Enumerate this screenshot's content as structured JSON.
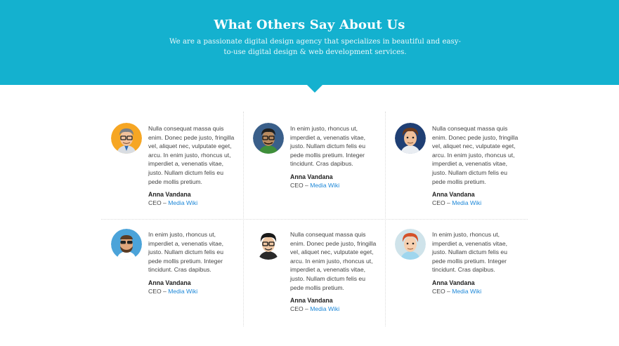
{
  "hero": {
    "title": "What Others Say About Us",
    "subtitle": "We are a passionate digital design agency that specializes in beautiful and easy-to-use digital design & web development services."
  },
  "colors": {
    "accent": "#14b1cf",
    "link": "#1e88d8"
  },
  "testimonials": [
    {
      "quote": "Nulla consequat massa quis enim. Donec pede justo, fringilla vel, aliquet nec, vulputate eget, arcu. In enim justo, rhoncus ut, imperdiet a, venenatis vitae, justo. Nullam dictum felis eu pede mollis pretium.",
      "name": "Anna Vandana",
      "role_prefix": "CEO – ",
      "company": "Media Wiki",
      "avatar": "man-glasses-orange-avatar-icon"
    },
    {
      "quote": "In enim justo, rhoncus ut, imperdiet a, venenatis vitae, justo. Nullam dictum felis eu pede mollis pretium. Integer tincidunt. Cras dapibus.",
      "name": "Anna Vandana",
      "role_prefix": "CEO – ",
      "company": "Media Wiki",
      "avatar": "man-glasses-green-avatar-icon"
    },
    {
      "quote": "Nulla consequat massa quis enim. Donec pede justo, fringilla vel, aliquet nec, vulputate eget, arcu. In enim justo, rhoncus ut, imperdiet a, venenatis vitae, justo. Nullam dictum felis eu pede mollis pretium.",
      "name": "Anna Vandana",
      "role_prefix": "CEO – ",
      "company": "Media Wiki",
      "avatar": "man-brown-hair-navy-avatar-icon"
    },
    {
      "quote": "In enim justo, rhoncus ut, imperdiet a, venenatis vitae, justo. Nullam dictum felis eu pede mollis pretium. Integer tincidunt. Cras dapibus.",
      "name": "Anna Vandana",
      "role_prefix": "CEO – ",
      "company": "Media Wiki",
      "avatar": "man-sunglasses-beard-avatar-icon"
    },
    {
      "quote": "Nulla consequat massa quis enim. Donec pede justo, fringilla vel, aliquet nec, vulputate eget, arcu. In enim justo, rhoncus ut, imperdiet a, venenatis vitae, justo. Nullam dictum felis eu pede mollis pretium.",
      "name": "Anna Vandana",
      "role_prefix": "CEO – ",
      "company": "Media Wiki",
      "avatar": "man-glasses-dark-hair-avatar-icon"
    },
    {
      "quote": "In enim justo, rhoncus ut, imperdiet a, venenatis vitae, justo. Nullam dictum felis eu pede mollis pretium. Integer tincidunt. Cras dapibus.",
      "name": "Anna Vandana",
      "role_prefix": "CEO – ",
      "company": "Media Wiki",
      "avatar": "man-red-hair-avatar-icon"
    }
  ]
}
